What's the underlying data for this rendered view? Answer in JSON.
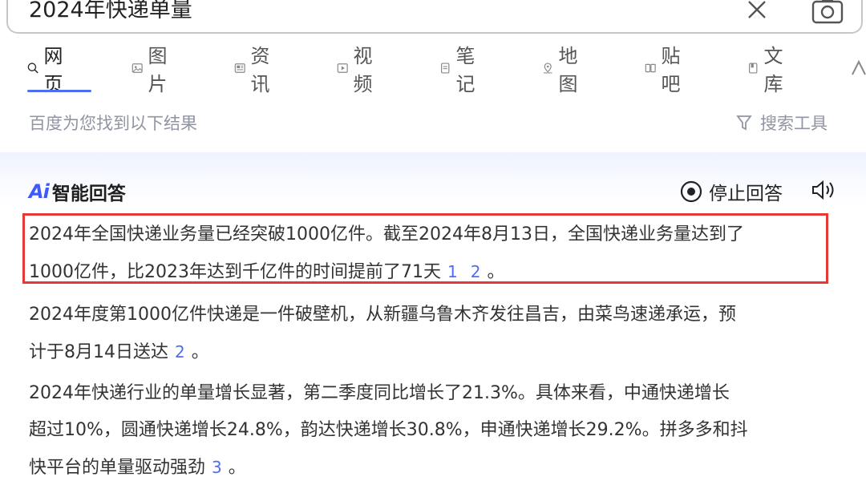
{
  "search": {
    "query": "2024年快递单量"
  },
  "tabs": [
    {
      "label": "网页",
      "icon": "search-icon"
    },
    {
      "label": "图片",
      "icon": "image-icon"
    },
    {
      "label": "资讯",
      "icon": "news-icon"
    },
    {
      "label": "视频",
      "icon": "video-icon"
    },
    {
      "label": "笔记",
      "icon": "note-icon"
    },
    {
      "label": "地图",
      "icon": "map-icon"
    },
    {
      "label": "贴吧",
      "icon": "tieba-icon"
    },
    {
      "label": "文库",
      "icon": "doc-icon"
    }
  ],
  "results": {
    "info": "百度为您找到以下结果",
    "tools_label": "搜索工具"
  },
  "ai": {
    "title": "智能回答",
    "logo": "Ai",
    "stop_label": "停止回答",
    "paragraphs": [
      {
        "lines": [
          "2024年全国快递业务量已经突破1000亿件。截至2024年8月13日，全国快递业务量达到了",
          "1000亿件，比2023年达到千亿件的时间提前了71天"
        ],
        "cites": [
          "1",
          "2"
        ],
        "tail": "。"
      },
      {
        "lines": [
          "2024年度第1000亿件快递是一件破壁机，从新疆乌鲁木齐发往昌吉，由菜鸟速递承运，预",
          "计于8月14日送达"
        ],
        "cites": [
          "2"
        ],
        "tail": "。"
      },
      {
        "lines": [
          "2024年快递行业的单量增长显著，第二季度同比增长了21.3%。具体来看，中通快递增长",
          "超过10%，圆通快递增长24.8%，韵达快递增长30.8%，申通快递增长29.2%。拼多多和抖",
          "快平台的单量驱动强劲"
        ],
        "cites": [
          "3"
        ],
        "tail": "。"
      }
    ]
  },
  "colors": {
    "accent": "#4e6ef2",
    "highlight_border": "#e53935"
  }
}
